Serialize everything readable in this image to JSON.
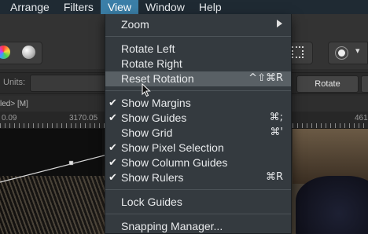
{
  "menubar": {
    "items": [
      "Arrange",
      "Filters",
      "View",
      "Window",
      "Help"
    ],
    "active": "View"
  },
  "context": {
    "units_label": "Units:",
    "rotate_label": "Rotate"
  },
  "document": {
    "tab_label": "led> [M]"
  },
  "ruler": {
    "labels": [
      "0.09",
      "3170.05",
      "461"
    ]
  },
  "view_menu": {
    "zoom": {
      "label": "Zoom"
    },
    "rotate_left": {
      "label": "Rotate Left"
    },
    "rotate_right": {
      "label": "Rotate Right"
    },
    "reset_rotation": {
      "label": "Reset Rotation",
      "shortcut": "^⇧⌘R"
    },
    "show_margins": {
      "label": "Show Margins",
      "checked": "✔"
    },
    "show_guides": {
      "label": "Show Guides",
      "checked": "✔",
      "shortcut": "⌘;"
    },
    "show_grid": {
      "label": "Show Grid",
      "shortcut": "⌘'"
    },
    "show_pixel_selection": {
      "label": "Show Pixel Selection",
      "checked": "✔"
    },
    "show_column_guides": {
      "label": "Show Column Guides",
      "checked": "✔"
    },
    "show_rulers": {
      "label": "Show Rulers",
      "checked": "✔",
      "shortcut": "⌘R"
    },
    "lock_guides": {
      "label": "Lock Guides"
    },
    "snapping_manager": {
      "label": "Snapping Manager..."
    }
  },
  "colors": {
    "menubar_bg": "#1f2a33",
    "active_menu": "#3b7fa8",
    "menu_bg": "#343a3f",
    "menu_highlight": "#596065"
  }
}
